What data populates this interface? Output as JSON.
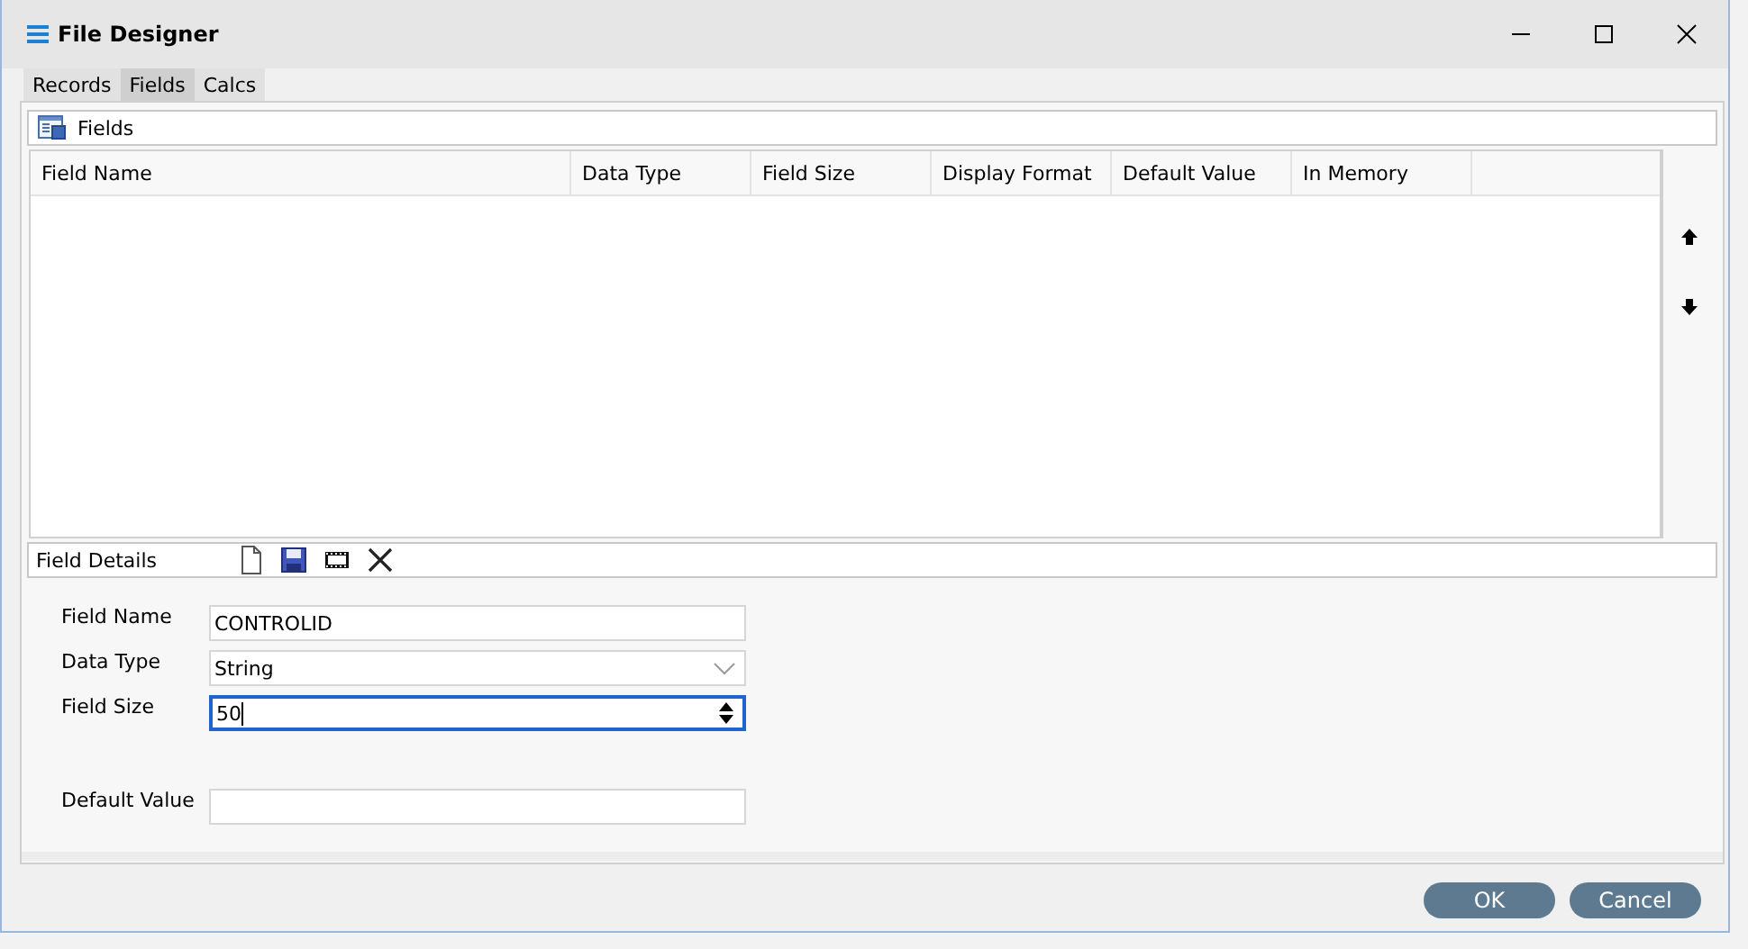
{
  "window": {
    "title": "File Designer"
  },
  "tabs": [
    {
      "label": "Records",
      "selected": false
    },
    {
      "label": "Fields",
      "selected": true
    },
    {
      "label": "Calcs",
      "selected": false
    }
  ],
  "fields_panel": {
    "title": "Fields",
    "columns": [
      "Field Name",
      "Data Type",
      "Field Size",
      "Display Format",
      "Default Value",
      "In Memory"
    ]
  },
  "details": {
    "title": "Field Details"
  },
  "form": [
    {
      "label": "Field Name",
      "kind": "text",
      "value": "CONTROLID",
      "focused": false
    },
    {
      "label": "Data Type",
      "kind": "dropdown",
      "value": "String",
      "focused": false
    },
    {
      "label": "Field Size",
      "kind": "spinner",
      "value": "50",
      "focused": true
    },
    {
      "label": "Default Value",
      "kind": "text",
      "focused": false
    }
  ],
  "buttons": [
    "OK",
    "Cancel"
  ]
}
